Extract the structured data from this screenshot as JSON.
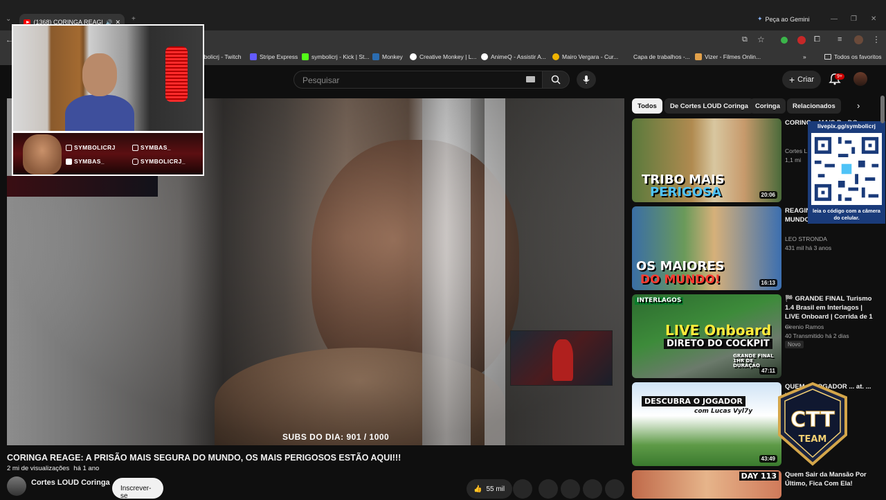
{
  "browser": {
    "tab_title": "(1368) CORINGA REAGE: A",
    "gemini_label": "Peça ao Gemini",
    "bookmarks": [
      "nbolicrj - Twitch",
      "Stripe Express",
      "symbolicrj - Kick | St...",
      "Monkey",
      "Creative Monkey | L...",
      "AnimeQ - Assistir A...",
      "Mairo Vergara - Cur...",
      "Capa de trabalhos -...",
      "Vizer - Filmes Onlin..."
    ],
    "all_bookmarks": "Todos os favoritos",
    "more_bookmarks": "»"
  },
  "youtube": {
    "search_placeholder": "Pesquisar",
    "create_label": "Criar",
    "notifications_badge": "9+"
  },
  "video": {
    "title": "CORINGA REAGE: A PRISÃO MAIS SEGURA DO MUNDO, OS MAIS PERIGOSOS ESTÃO AQUI!!!",
    "views": "2 mi de visualizações",
    "age": "há 1 ano",
    "channel": "Cortes LOUD Coringa",
    "subscribe_label": "Inscrever-se",
    "likes": "55 mil",
    "subs_counter": "SUBS DO DIA: 901 / 1000"
  },
  "overlay": {
    "social": [
      "SYMBOLICRJ",
      "SYMBAS_",
      "SYMBAS_",
      "SYMBOLICRJ_"
    ],
    "qr_url": "livepix.gg/symbolicrj",
    "qr_note": "leia o código com a câmera do celular.",
    "team_logo_top": "CTT",
    "team_logo_bottom": "TEAM"
  },
  "chips": [
    "Todos",
    "De Cortes LOUD Coringa",
    "Coringa",
    "Relacionados"
  ],
  "recommendations": [
    {
      "title": "CORING... MAIS P... DO...",
      "channel": "Cortes L...",
      "stats": "1,1 mi",
      "duration": "20:06",
      "caption_top": "TRIBO MAIS",
      "caption_bottom": "PERIGOSA"
    },
    {
      "title": "REAGIN... COM M... DO MUNDO! - LEO STRONDA",
      "channel": "LEO STRONDA",
      "stats": "431 mil   há 3 anos",
      "duration": "16:13",
      "caption_top": "OS MAIORES",
      "caption_bottom": "DO MUNDO!"
    },
    {
      "title": "🏁 GRANDE FINAL Turismo 1.4 Brasil em Interlagos | LIVE Onboard | Corrida de 1 ...",
      "channel": "Cirenio Ramos",
      "stats": "40   Transmitido há 2 dias",
      "badge": "Novo",
      "duration": "47:11",
      "caption_top": "LIVE Onboard",
      "caption_bottom": "DIRETO DO COCKPIT",
      "caption_small": "INTERLAGOS",
      "caption_final": "GRANDE FINAL 1HR DE DURAÇÃO"
    },
    {
      "title": "QUEM ... JOGADOR ... at. ... Vampeta",
      "duration": "43:49",
      "caption_top": "DESCUBRA O JOGADOR",
      "caption_bottom": "com Lucas Vyl7y"
    },
    {
      "title": "Quem Sair da Mansão Por Último, Fica Com Ela!",
      "caption_top": "DAY 113"
    }
  ]
}
